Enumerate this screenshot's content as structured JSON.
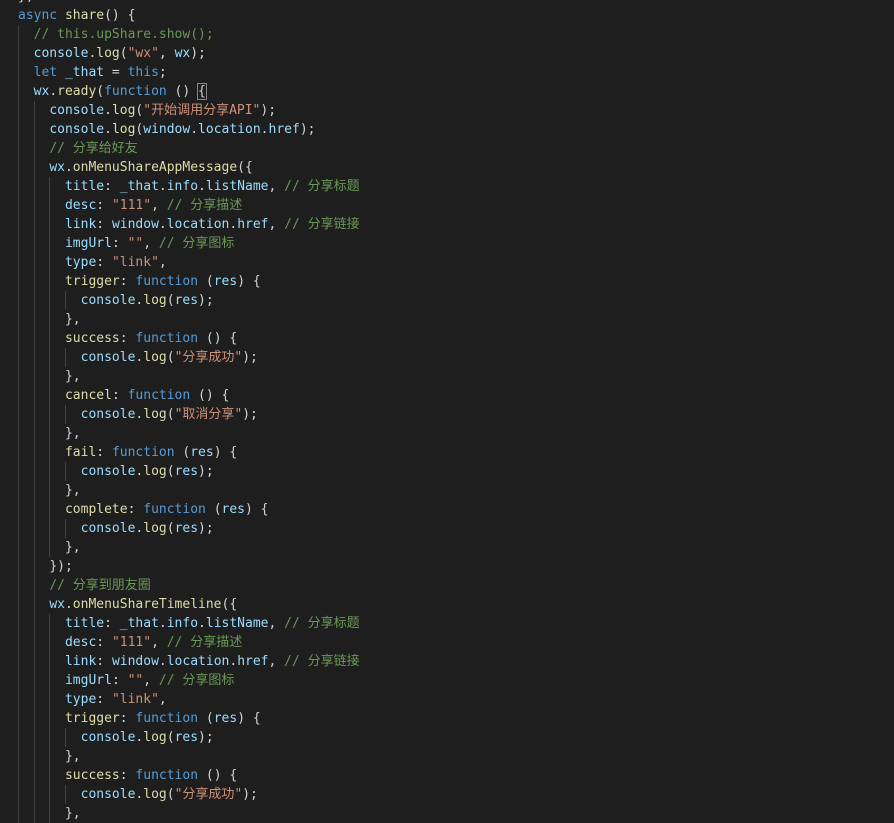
{
  "editor": {
    "theme_colors": {
      "background": "#1e1e1e",
      "keyword": "#569cd6",
      "function": "#dcdcaa",
      "variable": "#9cdcfe",
      "string": "#ce9178",
      "comment": "#6a9955",
      "punctuation": "#d4d4d4"
    },
    "lines": [
      {
        "indent": 0,
        "tokens": [
          [
            "pun",
            "},"
          ]
        ]
      },
      {
        "indent": 0,
        "tokens": [
          [
            "kw",
            "async"
          ],
          [
            "pun",
            " "
          ],
          [
            "fn",
            "share"
          ],
          [
            "pun",
            "() {"
          ]
        ]
      },
      {
        "indent": 1,
        "tokens": [
          [
            "cmt",
            "// this.upShare.show();"
          ]
        ]
      },
      {
        "indent": 1,
        "tokens": [
          [
            "var",
            "console"
          ],
          [
            "pun",
            "."
          ],
          [
            "fn",
            "log"
          ],
          [
            "pun",
            "("
          ],
          [
            "str",
            "\"wx\""
          ],
          [
            "pun",
            ", "
          ],
          [
            "var",
            "wx"
          ],
          [
            "pun",
            ");"
          ]
        ]
      },
      {
        "indent": 1,
        "tokens": [
          [
            "kw",
            "let"
          ],
          [
            "pun",
            " "
          ],
          [
            "var",
            "_that"
          ],
          [
            "pun",
            " = "
          ],
          [
            "kw",
            "this"
          ],
          [
            "pun",
            ";"
          ]
        ]
      },
      {
        "indent": 1,
        "tokens": [
          [
            "var",
            "wx"
          ],
          [
            "pun",
            "."
          ],
          [
            "fn",
            "ready"
          ],
          [
            "pun",
            "("
          ],
          [
            "kw",
            "function"
          ],
          [
            "pun",
            " () "
          ],
          [
            "brk",
            "{"
          ]
        ]
      },
      {
        "indent": 2,
        "tokens": [
          [
            "var",
            "console"
          ],
          [
            "pun",
            "."
          ],
          [
            "fn",
            "log"
          ],
          [
            "pun",
            "("
          ],
          [
            "str",
            "\"开始调用分享API\""
          ],
          [
            "pun",
            ");"
          ]
        ]
      },
      {
        "indent": 2,
        "tokens": [
          [
            "var",
            "console"
          ],
          [
            "pun",
            "."
          ],
          [
            "fn",
            "log"
          ],
          [
            "pun",
            "("
          ],
          [
            "var",
            "window"
          ],
          [
            "pun",
            "."
          ],
          [
            "var",
            "location"
          ],
          [
            "pun",
            "."
          ],
          [
            "var",
            "href"
          ],
          [
            "pun",
            ");"
          ]
        ]
      },
      {
        "indent": 2,
        "tokens": [
          [
            "cmt",
            "// 分享给好友"
          ]
        ]
      },
      {
        "indent": 2,
        "tokens": [
          [
            "var",
            "wx"
          ],
          [
            "pun",
            "."
          ],
          [
            "fn",
            "onMenuShareAppMessage"
          ],
          [
            "pun",
            "({"
          ]
        ]
      },
      {
        "indent": 3,
        "tokens": [
          [
            "var",
            "title"
          ],
          [
            "pun",
            ": "
          ],
          [
            "var",
            "_that"
          ],
          [
            "pun",
            "."
          ],
          [
            "var",
            "info"
          ],
          [
            "pun",
            "."
          ],
          [
            "var",
            "listName"
          ],
          [
            "pun",
            ", "
          ],
          [
            "cmt",
            "// 分享标题"
          ]
        ]
      },
      {
        "indent": 3,
        "tokens": [
          [
            "var",
            "desc"
          ],
          [
            "pun",
            ": "
          ],
          [
            "str",
            "\"111\""
          ],
          [
            "pun",
            ", "
          ],
          [
            "cmt",
            "// 分享描述"
          ]
        ]
      },
      {
        "indent": 3,
        "tokens": [
          [
            "var",
            "link"
          ],
          [
            "pun",
            ": "
          ],
          [
            "var",
            "window"
          ],
          [
            "pun",
            "."
          ],
          [
            "var",
            "location"
          ],
          [
            "pun",
            "."
          ],
          [
            "var",
            "href"
          ],
          [
            "pun",
            ", "
          ],
          [
            "cmt",
            "// 分享链接"
          ]
        ]
      },
      {
        "indent": 3,
        "tokens": [
          [
            "var",
            "imgUrl"
          ],
          [
            "pun",
            ": "
          ],
          [
            "str",
            "\"\""
          ],
          [
            "pun",
            ", "
          ],
          [
            "cmt",
            "// 分享图标"
          ]
        ]
      },
      {
        "indent": 3,
        "tokens": [
          [
            "var",
            "type"
          ],
          [
            "pun",
            ": "
          ],
          [
            "str",
            "\"link\""
          ],
          [
            "pun",
            ","
          ]
        ]
      },
      {
        "indent": 3,
        "tokens": [
          [
            "fn",
            "trigger"
          ],
          [
            "pun",
            ": "
          ],
          [
            "kw",
            "function"
          ],
          [
            "pun",
            " ("
          ],
          [
            "var",
            "res"
          ],
          [
            "pun",
            ") {"
          ]
        ]
      },
      {
        "indent": 4,
        "tokens": [
          [
            "var",
            "console"
          ],
          [
            "pun",
            "."
          ],
          [
            "fn",
            "log"
          ],
          [
            "pun",
            "("
          ],
          [
            "var",
            "res"
          ],
          [
            "pun",
            ");"
          ]
        ]
      },
      {
        "indent": 3,
        "tokens": [
          [
            "pun",
            "},"
          ]
        ]
      },
      {
        "indent": 3,
        "tokens": [
          [
            "fn",
            "success"
          ],
          [
            "pun",
            ": "
          ],
          [
            "kw",
            "function"
          ],
          [
            "pun",
            " () {"
          ]
        ]
      },
      {
        "indent": 4,
        "tokens": [
          [
            "var",
            "console"
          ],
          [
            "pun",
            "."
          ],
          [
            "fn",
            "log"
          ],
          [
            "pun",
            "("
          ],
          [
            "str",
            "\"分享成功\""
          ],
          [
            "pun",
            ");"
          ]
        ]
      },
      {
        "indent": 3,
        "tokens": [
          [
            "pun",
            "},"
          ]
        ]
      },
      {
        "indent": 3,
        "tokens": [
          [
            "fn",
            "cancel"
          ],
          [
            "pun",
            ": "
          ],
          [
            "kw",
            "function"
          ],
          [
            "pun",
            " () {"
          ]
        ]
      },
      {
        "indent": 4,
        "tokens": [
          [
            "var",
            "console"
          ],
          [
            "pun",
            "."
          ],
          [
            "fn",
            "log"
          ],
          [
            "pun",
            "("
          ],
          [
            "str",
            "\"取消分享\""
          ],
          [
            "pun",
            ");"
          ]
        ]
      },
      {
        "indent": 3,
        "tokens": [
          [
            "pun",
            "},"
          ]
        ]
      },
      {
        "indent": 3,
        "tokens": [
          [
            "fn",
            "fail"
          ],
          [
            "pun",
            ": "
          ],
          [
            "kw",
            "function"
          ],
          [
            "pun",
            " ("
          ],
          [
            "var",
            "res"
          ],
          [
            "pun",
            ") {"
          ]
        ]
      },
      {
        "indent": 4,
        "tokens": [
          [
            "var",
            "console"
          ],
          [
            "pun",
            "."
          ],
          [
            "fn",
            "log"
          ],
          [
            "pun",
            "("
          ],
          [
            "var",
            "res"
          ],
          [
            "pun",
            ");"
          ]
        ]
      },
      {
        "indent": 3,
        "tokens": [
          [
            "pun",
            "},"
          ]
        ]
      },
      {
        "indent": 3,
        "tokens": [
          [
            "fn",
            "complete"
          ],
          [
            "pun",
            ": "
          ],
          [
            "kw",
            "function"
          ],
          [
            "pun",
            " ("
          ],
          [
            "var",
            "res"
          ],
          [
            "pun",
            ") {"
          ]
        ]
      },
      {
        "indent": 4,
        "tokens": [
          [
            "var",
            "console"
          ],
          [
            "pun",
            "."
          ],
          [
            "fn",
            "log"
          ],
          [
            "pun",
            "("
          ],
          [
            "var",
            "res"
          ],
          [
            "pun",
            ");"
          ]
        ]
      },
      {
        "indent": 3,
        "tokens": [
          [
            "pun",
            "},"
          ]
        ]
      },
      {
        "indent": 2,
        "tokens": [
          [
            "pun",
            "});"
          ]
        ]
      },
      {
        "indent": 2,
        "tokens": [
          [
            "cmt",
            "// 分享到朋友圈"
          ]
        ]
      },
      {
        "indent": 2,
        "tokens": [
          [
            "var",
            "wx"
          ],
          [
            "pun",
            "."
          ],
          [
            "fn",
            "onMenuShareTimeline"
          ],
          [
            "pun",
            "({"
          ]
        ]
      },
      {
        "indent": 3,
        "tokens": [
          [
            "var",
            "title"
          ],
          [
            "pun",
            ": "
          ],
          [
            "var",
            "_that"
          ],
          [
            "pun",
            "."
          ],
          [
            "var",
            "info"
          ],
          [
            "pun",
            "."
          ],
          [
            "var",
            "listName"
          ],
          [
            "pun",
            ", "
          ],
          [
            "cmt",
            "// 分享标题"
          ]
        ]
      },
      {
        "indent": 3,
        "tokens": [
          [
            "var",
            "desc"
          ],
          [
            "pun",
            ": "
          ],
          [
            "str",
            "\"111\""
          ],
          [
            "pun",
            ", "
          ],
          [
            "cmt",
            "// 分享描述"
          ]
        ]
      },
      {
        "indent": 3,
        "tokens": [
          [
            "var",
            "link"
          ],
          [
            "pun",
            ": "
          ],
          [
            "var",
            "window"
          ],
          [
            "pun",
            "."
          ],
          [
            "var",
            "location"
          ],
          [
            "pun",
            "."
          ],
          [
            "var",
            "href"
          ],
          [
            "pun",
            ", "
          ],
          [
            "cmt",
            "// 分享链接"
          ]
        ]
      },
      {
        "indent": 3,
        "tokens": [
          [
            "var",
            "imgUrl"
          ],
          [
            "pun",
            ": "
          ],
          [
            "str",
            "\"\""
          ],
          [
            "pun",
            ", "
          ],
          [
            "cmt",
            "// 分享图标"
          ]
        ]
      },
      {
        "indent": 3,
        "tokens": [
          [
            "var",
            "type"
          ],
          [
            "pun",
            ": "
          ],
          [
            "str",
            "\"link\""
          ],
          [
            "pun",
            ","
          ]
        ]
      },
      {
        "indent": 3,
        "tokens": [
          [
            "fn",
            "trigger"
          ],
          [
            "pun",
            ": "
          ],
          [
            "kw",
            "function"
          ],
          [
            "pun",
            " ("
          ],
          [
            "var",
            "res"
          ],
          [
            "pun",
            ") {"
          ]
        ]
      },
      {
        "indent": 4,
        "tokens": [
          [
            "var",
            "console"
          ],
          [
            "pun",
            "."
          ],
          [
            "fn",
            "log"
          ],
          [
            "pun",
            "("
          ],
          [
            "var",
            "res"
          ],
          [
            "pun",
            ");"
          ]
        ]
      },
      {
        "indent": 3,
        "tokens": [
          [
            "pun",
            "},"
          ]
        ]
      },
      {
        "indent": 3,
        "tokens": [
          [
            "fn",
            "success"
          ],
          [
            "pun",
            ": "
          ],
          [
            "kw",
            "function"
          ],
          [
            "pun",
            " () {"
          ]
        ]
      },
      {
        "indent": 4,
        "tokens": [
          [
            "var",
            "console"
          ],
          [
            "pun",
            "."
          ],
          [
            "fn",
            "log"
          ],
          [
            "pun",
            "("
          ],
          [
            "str",
            "\"分享成功\""
          ],
          [
            "pun",
            ");"
          ]
        ]
      },
      {
        "indent": 3,
        "tokens": [
          [
            "pun",
            "},"
          ]
        ]
      }
    ]
  }
}
